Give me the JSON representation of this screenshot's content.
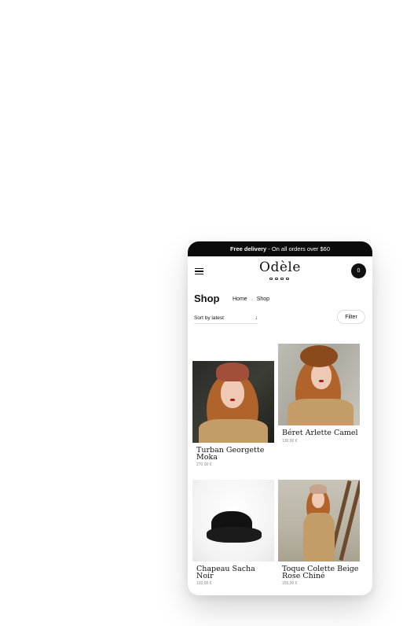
{
  "promo": {
    "bold": "Free delivery",
    "text": " - On all orders over $60"
  },
  "header": {
    "logo": "Odèle",
    "cart_count": "0"
  },
  "page": {
    "title": "Shop"
  },
  "breadcrumb": {
    "home": "Home",
    "separator": "→",
    "current": "Shop"
  },
  "controls": {
    "sort_label": "Sort by latest",
    "sort_arrow": "↓",
    "filter_label": "Filter"
  },
  "products": [
    {
      "name": "Turban Georgette Moka",
      "price": "270,00 €",
      "icon": "turban-hat-photo"
    },
    {
      "name": "Béret Arlette Camel",
      "price": "130,00 €",
      "icon": "beret-photo"
    },
    {
      "name": "Chapeau Sacha Noir",
      "price": "120,00 €",
      "icon": "black-hat-photo"
    },
    {
      "name": "Toque Colette Beige Rose Chiné",
      "price": "155,00 €",
      "icon": "toque-photo"
    }
  ],
  "colors": {
    "promo_bg": "#0b0b0b",
    "cart_bg": "#111111",
    "background": "#ffffff"
  }
}
